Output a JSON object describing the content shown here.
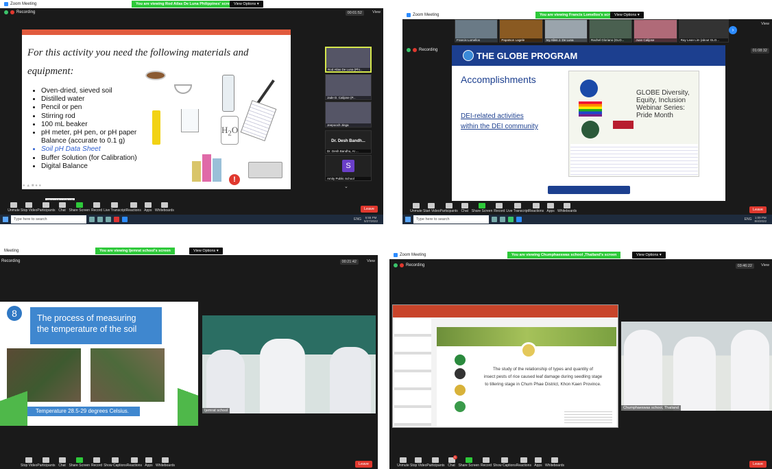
{
  "q1": {
    "title": "Zoom Meeting",
    "banner": "You are viewing Rod Atlas De Luna Philippines' screen",
    "view_options": "View Options ▾",
    "recording": "Recording",
    "timer": "00:01:52",
    "view": "View",
    "slide_heading_1": "For this activity you need the following materials and",
    "slide_heading_2": "equipment:",
    "materials": [
      "Oven-dried, sieved soil",
      "Distilled water",
      "Pencil or pen",
      "Stirring rod",
      "100 mL beaker",
      "pH meter, pH pen, or pH paper",
      "Balance (accurate to 0.1 g)",
      "Soil pH Data Sheet",
      "Buffer Solution (for Calibration)",
      "Digital Balance"
    ],
    "participants": [
      "Rod Atlas De Luna (Phi...",
      "Jade D. Calijose (P...",
      "Jeepooch Jinga",
      "Dr. Desh Bandh...",
      "Dr. Desh Bandhu, AI ...",
      "Amity Public School"
    ],
    "avatar_letter": "S",
    "tooltip": "Stop Video (Alt+V)",
    "tb_count": "42",
    "toolbar": [
      "Unmute",
      "Stop Video",
      "Participants",
      "Chat",
      "Share Screen",
      "Record",
      "Live Transcript",
      "Reactions",
      "Apps",
      "Whiteboards"
    ],
    "leave": "Leave",
    "search_placeholder": "Type here to search",
    "clock_time": "5:55 PM",
    "clock_date": "5/27/2022",
    "lang": "ENG"
  },
  "q2": {
    "title": "Zoom Meeting",
    "banner": "You are viewing Francis Lomellos's screen",
    "view_options": "View Options ▾",
    "recording": "Recording",
    "timer": "01:08:32",
    "view": "View",
    "participants": [
      "Francis Lomellos",
      "Papatson Lagele",
      "Ivy Allen J. De Luna",
      "Rachel Gloriano (GLO...",
      "Juan Calijose",
      "Ray Lean Lim (about GLO..."
    ],
    "program": "THE GLOBE PROGRAM",
    "accomplishments": "Accomplishments",
    "dei_1": "DEI-related activities",
    "dei_2": "within the DEI community",
    "webinar": [
      "GLOBE Diversity,",
      "Equity, Inclusion",
      "Webinar Series:",
      "Pride Month"
    ],
    "tb_count": "21",
    "toolbar": [
      "Unmute",
      "Start Video",
      "Participants",
      "Chat",
      "Share Screen",
      "Record",
      "Live Transcript",
      "Reactions",
      "Apps",
      "Whiteboards"
    ],
    "leave": "Leave",
    "search_placeholder": "Type here to search",
    "clock_time": "1:09 PM",
    "clock_date": "8/4/2022",
    "lang": "ENG"
  },
  "q3": {
    "title": "Meeting",
    "banner": "You are viewing Ijemrat school's screen",
    "view_options": "View Options ▾",
    "recording": "Recording",
    "timer": "00:21:42",
    "view": "View",
    "number": "8",
    "slide_title_1": "The process of measuring",
    "slide_title_2": "the temperature of the soil",
    "caption": "Temperature 28.5-29 degrees Celsius.",
    "video_name": "Ijemrat school",
    "tb_count": "50",
    "toolbar": [
      "Stop Video",
      "Participants",
      "Chat",
      "Share Screen",
      "Record",
      "Show Captions",
      "Reactions",
      "Apps",
      "Whiteboards"
    ],
    "leave": "Leave"
  },
  "q4": {
    "title": "Zoom Meeting",
    "banner": "You are viewing Chumphaeswas school ,Thailand's screen",
    "view_options": "View Options ▾",
    "recording": "Recording",
    "timer": "03:46:22",
    "view": "View",
    "study_1": "The study of the relationship of types and quantity of",
    "study_2": "insect pests of rice caused leaf damage during seedling stage",
    "study_3": "to tillering stage in Chum Phae District, Khon Kaen Province.",
    "video_name": "Chumphaeswas school, Thailand",
    "tb_count": "65",
    "chat_badge": "3",
    "toolbar": [
      "Unmute",
      "Stop Video",
      "Participants",
      "Chat",
      "Share Screen",
      "Record",
      "Show Captions",
      "Reactions",
      "Apps",
      "Whiteboards"
    ],
    "leave": "Leave"
  },
  "colors": {
    "banner_green": "#2ec93a",
    "leave_red": "#e0382e",
    "zoom_dark": "#1a1a1a",
    "globe_blue": "#1c3f8f",
    "slide_blue": "#2f78c4"
  }
}
